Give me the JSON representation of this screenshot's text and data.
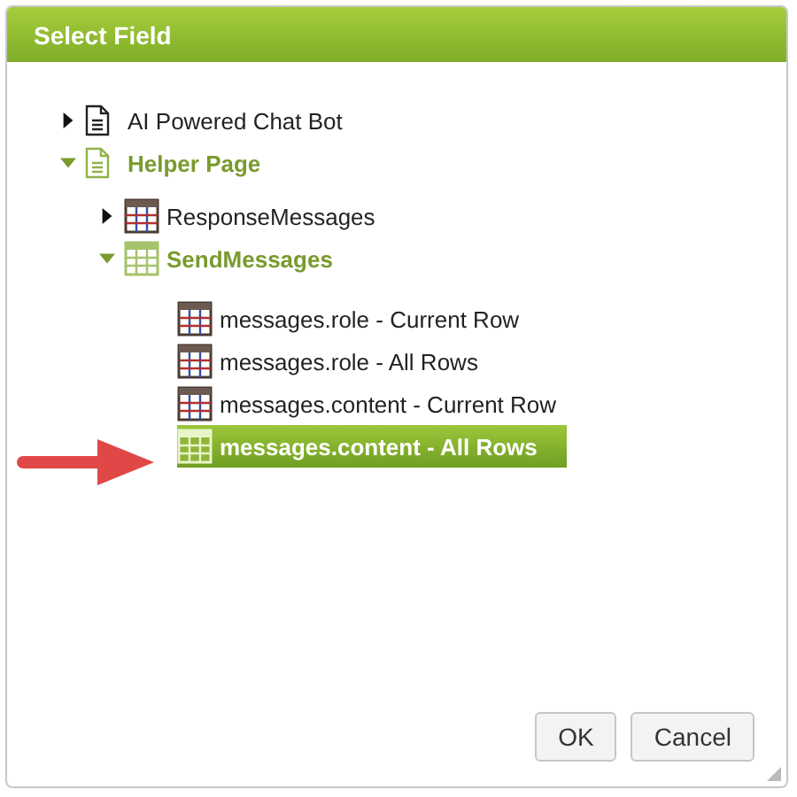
{
  "window": {
    "title": "Select Field"
  },
  "tree": [
    {
      "label": "AI Powered Chat Bot",
      "kind": "page",
      "expanded": false,
      "selected": false
    },
    {
      "label": "Helper Page",
      "kind": "page",
      "expanded": true,
      "selected": false,
      "children": [
        {
          "label": "ResponseMessages",
          "kind": "table",
          "expanded": false,
          "selected": false
        },
        {
          "label": "SendMessages",
          "kind": "table",
          "expanded": true,
          "selected": false,
          "children": [
            {
              "label": "messages.role - Current Row",
              "kind": "field",
              "selected": false
            },
            {
              "label": "messages.role - All Rows",
              "kind": "field",
              "selected": false
            },
            {
              "label": "messages.content - Current Row",
              "kind": "field",
              "selected": false
            },
            {
              "label": "messages.content - All Rows",
              "kind": "field",
              "selected": true
            }
          ]
        }
      ]
    }
  ],
  "buttons": [
    "OK",
    "Cancel"
  ]
}
